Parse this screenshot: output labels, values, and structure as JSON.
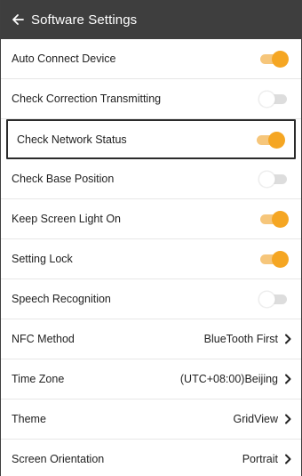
{
  "colors": {
    "appbar_bg": "#3e3e3e",
    "accent": "#f5a623",
    "track_on": "#f6c67b",
    "track_off": "#dddddd"
  },
  "header": {
    "back_icon": "arrow-left-icon",
    "title": "Software Settings"
  },
  "toggles": [
    {
      "label": "Auto Connect Device",
      "on": true
    },
    {
      "label": "Check Correction Transmitting",
      "on": false
    },
    {
      "label": "Check Network Status",
      "on": true
    },
    {
      "label": "Check Base Position",
      "on": false
    },
    {
      "label": "Keep Screen Light On",
      "on": true
    },
    {
      "label": "Setting Lock",
      "on": true
    },
    {
      "label": "Speech Recognition",
      "on": false
    }
  ],
  "selects": [
    {
      "label": "NFC Method",
      "value": "BlueTooth First",
      "icon": "chevron-right-icon"
    },
    {
      "label": "Time Zone",
      "value": "(UTC+08:00)Beijing",
      "icon": "chevron-right-icon"
    },
    {
      "label": "Theme",
      "value": "GridView",
      "icon": "chevron-right-icon"
    },
    {
      "label": "Screen Orientation",
      "value": "Portrait",
      "icon": "chevron-right-icon"
    }
  ]
}
